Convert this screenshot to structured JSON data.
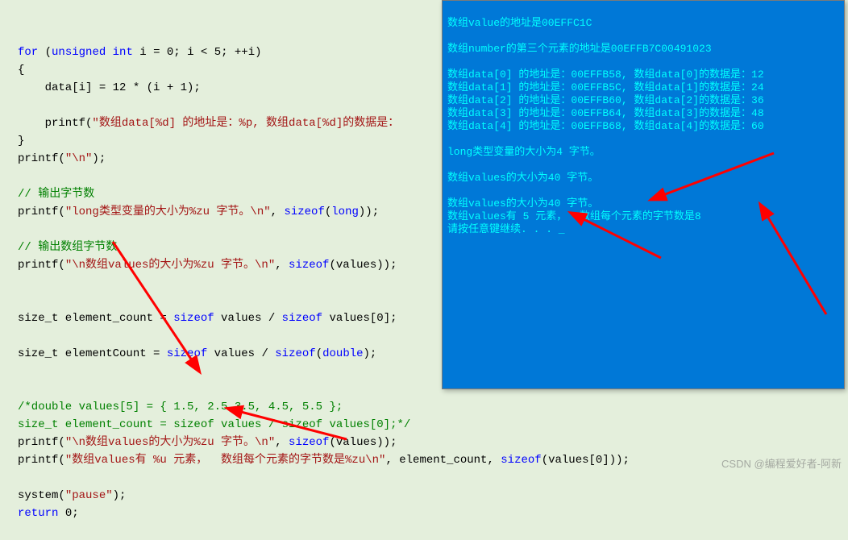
{
  "code": {
    "l1_kw1": "for",
    "l1_p1": " (",
    "l1_kw2": "unsigned",
    "l1_p2": " ",
    "l1_kw3": "int",
    "l1_p3": " i = 0; i < 5; ++i)",
    "l2": "{",
    "l3": "    data[i] = 12 * (i + 1);",
    "l4": "",
    "l5_p1": "    printf(",
    "l5_s": "\"数组data[%d] 的地址是：%p, 数组data[%d]的数据是：",
    "l5_p2": "",
    "l6": "}",
    "l7_p1": "printf(",
    "l7_s": "\"\\n\"",
    "l7_p2": ");",
    "l8": "",
    "l9_c": "// 输出字节数",
    "l10_p1": "printf(",
    "l10_s": "\"long类型变量的大小为%zu 字节。\\n\"",
    "l10_p2": ", ",
    "l10_kw": "sizeof",
    "l10_p3": "(",
    "l10_kw2": "long",
    "l10_p4": "));",
    "l11": "",
    "l12_c": "// 输出数组字节数",
    "l13_p1": "printf(",
    "l13_s": "\"\\n数组values的大小为%zu 字节。\\n\"",
    "l13_p2": ", ",
    "l13_kw": "sizeof",
    "l13_p3": "(values));",
    "l14": "",
    "l15": "",
    "l16_p1": "size_t element_count = ",
    "l16_kw": "sizeof",
    "l16_p2": " values / ",
    "l16_kw2": "sizeof",
    "l16_p3": " values[0];",
    "l17": "",
    "l18_p1": "size_t elementCount = ",
    "l18_kw": "sizeof",
    "l18_p2": " values / ",
    "l18_kw2": "sizeof",
    "l18_p3": "(",
    "l18_kw3": "double",
    "l18_p4": ");",
    "l19": "",
    "l20": "",
    "l21_c": "/*double values[5] = { 1.5, 2.5,3.5, 4.5, 5.5 };",
    "l22_c": "size_t element_count = sizeof values / sizeof values[0];*/",
    "l23_p1": "printf(",
    "l23_s": "\"\\n数组values的大小为%zu 字节。\\n\"",
    "l23_p2": ", ",
    "l23_kw": "sizeof",
    "l23_p3": "(values));",
    "l24_p1": "printf(",
    "l24_s": "\"数组values有 %u 元素，  数组每个元素的字节数是%zu\\n\"",
    "l24_p2": ", element_count, ",
    "l24_kw": "sizeof",
    "l24_p3": "(values[0]));",
    "l25": "",
    "l26_p1": "system(",
    "l26_s": "\"pause\"",
    "l26_p2": ");",
    "l27_kw": "return",
    "l27_p": " 0;"
  },
  "console": {
    "l1": "数组value的地址是00EFFC1C",
    "l2": "",
    "l3": "数组number的第三个元素的地址是00EFFB7C00491023",
    "l4": "",
    "l5": "数组data[0] 的地址是：00EFFB58, 数组data[0]的数据是：12",
    "l6": "数组data[1] 的地址是：00EFFB5C, 数组data[1]的数据是：24",
    "l7": "数组data[2] 的地址是：00EFFB60, 数组data[2]的数据是：36",
    "l8": "数组data[3] 的地址是：00EFFB64, 数组data[3]的数据是：48",
    "l9": "数组data[4] 的地址是：00EFFB68, 数组data[4]的数据是：60",
    "l10": "",
    "l11": "long类型变量的大小为4 字节。",
    "l12": "",
    "l13": "数组values的大小为40 字节。",
    "l14": "",
    "l15": "数组values的大小为40 字节。",
    "l16": "数组values有 5 元素，  数组每个元素的字节数是8",
    "l17": "请按任意键继续. . . _"
  },
  "watermark": "CSDN @编程爱好者-阿新"
}
